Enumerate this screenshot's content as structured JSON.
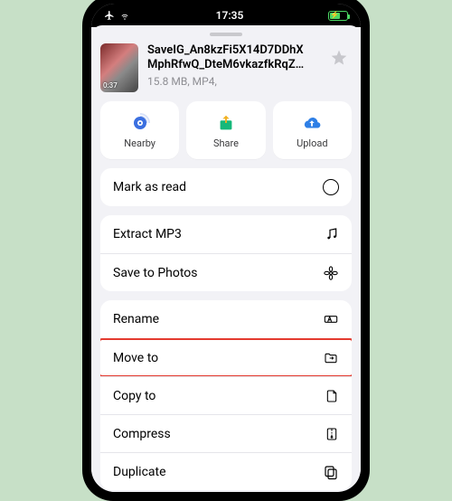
{
  "status": {
    "time": "17:35"
  },
  "file": {
    "name_line1": "SaveIG_An8kzFi5X14D7DDhX",
    "name_line2": "MphRfwQ_DteM6vkazfkRqZ…",
    "sub": "15.8 MB, MP4,",
    "duration": "0:37"
  },
  "actions": {
    "nearby": "Nearby",
    "share": "Share",
    "upload": "Upload"
  },
  "menu": {
    "mark_as_read": "Mark as read",
    "extract_mp3": "Extract MP3",
    "save_to_photos": "Save to Photos",
    "rename": "Rename",
    "move_to": "Move to",
    "copy_to": "Copy to",
    "compress": "Compress",
    "duplicate": "Duplicate"
  }
}
